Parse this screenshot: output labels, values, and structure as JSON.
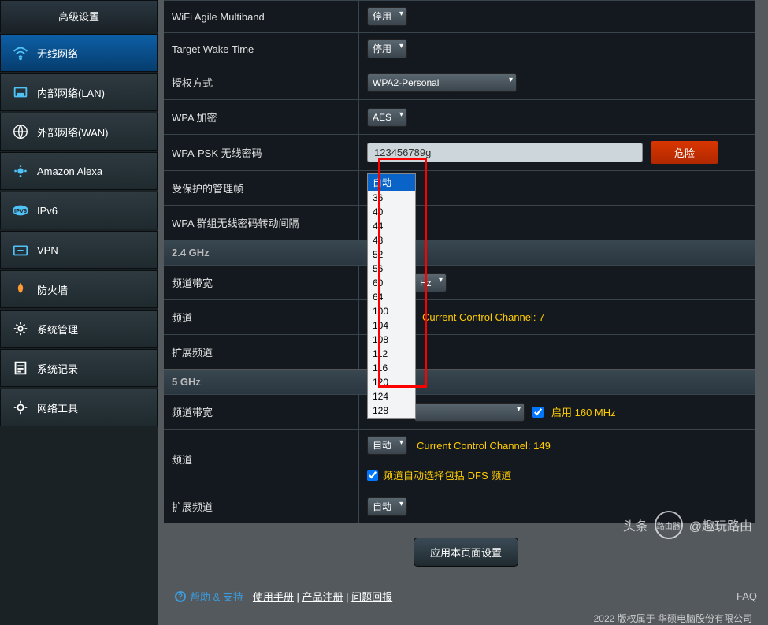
{
  "sidebar": {
    "header": "高级设置",
    "items": [
      {
        "label": "无线网络"
      },
      {
        "label": "内部网络(LAN)"
      },
      {
        "label": "外部网络(WAN)"
      },
      {
        "label": "Amazon Alexa"
      },
      {
        "label": "IPv6"
      },
      {
        "label": "VPN"
      },
      {
        "label": "防火墙"
      },
      {
        "label": "系统管理"
      },
      {
        "label": "系统记录"
      },
      {
        "label": "网络工具"
      }
    ]
  },
  "form": {
    "wifi_agile": {
      "label": "WiFi Agile Multiband",
      "value": "停用"
    },
    "target_wake": {
      "label": "Target Wake Time",
      "value": "停用"
    },
    "auth_method": {
      "label": "授权方式",
      "value": "WPA2-Personal"
    },
    "wpa_enc": {
      "label": "WPA 加密",
      "value": "AES"
    },
    "wpa_psk": {
      "label": "WPA-PSK 无线密码",
      "value": "123456789g",
      "danger": "危险"
    },
    "pmf": {
      "label": "受保护的管理帧",
      "value": "自动"
    },
    "group_key": {
      "label": "WPA 群组无线密码转动间隔"
    },
    "section_24": "2.4 GHz",
    "bw24": {
      "label": "频道带宽",
      "value": "Hz"
    },
    "ch24": {
      "label": "频道",
      "note": "Current Control Channel: 7"
    },
    "ext24": {
      "label": "扩展频道"
    },
    "section_5": "5 GHz",
    "bw5": {
      "label": "频道带宽",
      "enable160": "启用 160 MHz"
    },
    "ch5": {
      "label": "频道",
      "value": "自动",
      "note": "Current Control Channel: 149",
      "dfs": "频道自动选择包括 DFS 频道"
    },
    "ext5": {
      "label": "扩展频道",
      "value": "自动"
    }
  },
  "dropdown_options": [
    "自动",
    "36",
    "40",
    "44",
    "48",
    "52",
    "56",
    "60",
    "64",
    "100",
    "104",
    "108",
    "112",
    "116",
    "120",
    "124",
    "128"
  ],
  "apply": "应用本页面设置",
  "footer": {
    "help": "帮助 & 支持",
    "links": {
      "manual": "使用手册",
      "reg": "产品注册",
      "feedback": "问题回报"
    },
    "faq": "FAQ",
    "copyright": "2022 版权属于 华硕电脑股份有限公司"
  },
  "watermark": {
    "head": "头条",
    "at": "@趣玩路由",
    "side": "路由器"
  }
}
